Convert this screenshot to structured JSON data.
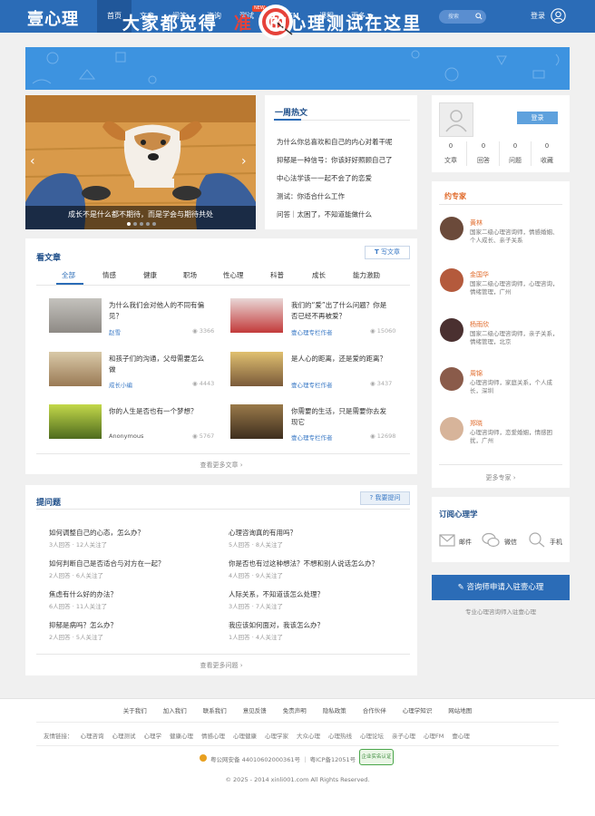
{
  "brand": {
    "logo": "壹心理",
    "accent": "#2b6cb7"
  },
  "nav": {
    "items": [
      "首页",
      "文章",
      "问答",
      "咨询",
      "测试",
      "心理FM",
      "课程",
      "更多"
    ],
    "new_badge": "NEW",
    "search_placeholder": "搜索",
    "login": "登录"
  },
  "banner": {
    "text_left": "大家都觉得",
    "text_mid": "准",
    "text_right": "的心理测试在这里"
  },
  "carousel": {
    "caption": "成长不是什么都不期待，而是学会与期待共处"
  },
  "hot": {
    "title": "一周热文",
    "items": [
      "为什么你总喜欢和自己的内心对着干呢",
      "抑郁是一种信号：你该好好照顾自己了",
      "中心法学该一一起不会了的恋爱",
      "测试：你适合什么工作",
      "问答｜太困了，不知道能做什么"
    ]
  },
  "profile": {
    "login_btn": "登录",
    "stats": [
      {
        "num": "0",
        "label": "文章"
      },
      {
        "num": "0",
        "label": "回答"
      },
      {
        "num": "0",
        "label": "问题"
      },
      {
        "num": "0",
        "label": "收藏"
      }
    ]
  },
  "experts": {
    "title": "约专家",
    "items": [
      {
        "name": "黄林",
        "desc": "国家二级心理咨询师，情感婚姻、个人成长、亲子关系"
      },
      {
        "name": "金国华",
        "desc": "国家二级心理咨询师，心理咨询，情绪管理，广州"
      },
      {
        "name": "杨雨欣",
        "desc": "国家二级心理咨询师，亲子关系，情绪管理，北京"
      },
      {
        "name": "周锦",
        "desc": "心理咨询师，家庭关系，个人成长，深圳"
      },
      {
        "name": "郑晓",
        "desc": "心理咨询师，恋爱婚姻，情感困扰，广州"
      }
    ],
    "more": "更多专家 ›"
  },
  "articles": {
    "title": "看文章",
    "write_btn": "写文章",
    "tabs": [
      "全部",
      "情感",
      "健康",
      "职场",
      "性心理",
      "科普",
      "成长",
      "能力激励"
    ],
    "items": [
      {
        "title": "为什么我们会对他人的不同有偏见？",
        "author": "赵雪",
        "views": "3366"
      },
      {
        "title": "我们的“爱”出了什么问题？你是否已经不再被爱？",
        "author": "壹心理专栏作者",
        "views": "15060"
      },
      {
        "title": "和孩子们的沟通，父母需要怎么做",
        "author": "成长小编",
        "views": "4443"
      },
      {
        "title": "是人心的距离，还是爱的距离？",
        "author": "壹心理专栏作者",
        "views": "3437"
      },
      {
        "title": "你的人生是否也有一个梦想？",
        "author": "Anonymous",
        "views": "5767"
      },
      {
        "title": "你需要的生活，只是需要你去发现它",
        "author": "壹心理专栏作者",
        "views": "12698"
      }
    ],
    "more": "查看更多文章 ›"
  },
  "questions": {
    "title": "提问题",
    "ask_btn": "我要提问",
    "items": [
      {
        "title": "如何调整自己的心态，怎么办？",
        "meta": "3人回答 · 12人关注了"
      },
      {
        "title": "心理咨询真的有用吗？",
        "meta": "5人回答 · 8人关注了"
      },
      {
        "title": "如何判断自己是否适合与对方在一起？",
        "meta": "2人回答 · 6人关注了"
      },
      {
        "title": "你是否也有过这种想法？不想和别人说话怎么办？",
        "meta": "4人回答 · 9人关注了"
      },
      {
        "title": "焦虑有什么好的办法？",
        "meta": "6人回答 · 11人关注了"
      },
      {
        "title": "人际关系，不知道该怎么处理？",
        "meta": "3人回答 · 7人关注了"
      },
      {
        "title": "抑郁是病吗？怎么办？",
        "meta": "2人回答 · 5人关注了"
      },
      {
        "title": "我应该如何面对，我该怎么办？",
        "meta": "1人回答 · 4人关注了"
      }
    ],
    "more": "查看更多问题 ›"
  },
  "subscribe": {
    "title": "订阅心理学",
    "items": [
      "邮件",
      "微信",
      "手机"
    ]
  },
  "consult": {
    "button": "咨询师申请入驻壹心理",
    "note": "专业心理咨询师入驻壹心理"
  },
  "footer": {
    "links": [
      "关于我们",
      "加入我们",
      "联系我们",
      "意见反馈",
      "免责声明",
      "隐私政策",
      "合作伙伴",
      "心理学知识",
      "网站地图"
    ],
    "friends_label": "友情链接：",
    "friends": [
      "心理咨询",
      "心理测试",
      "心理学",
      "健康心理",
      "情感心理",
      "心理健康",
      "心理学家",
      "大众心理",
      "心理热线",
      "心理论坛",
      "亲子心理",
      "心理FM",
      "壹心理"
    ],
    "icp": "粤公网安备 44010602000361号 ｜ 粤ICP备12051号",
    "badge": "企业实名认证",
    "copyright": "© 2025 - 2014 xinli001.com All Rights Reserved."
  }
}
